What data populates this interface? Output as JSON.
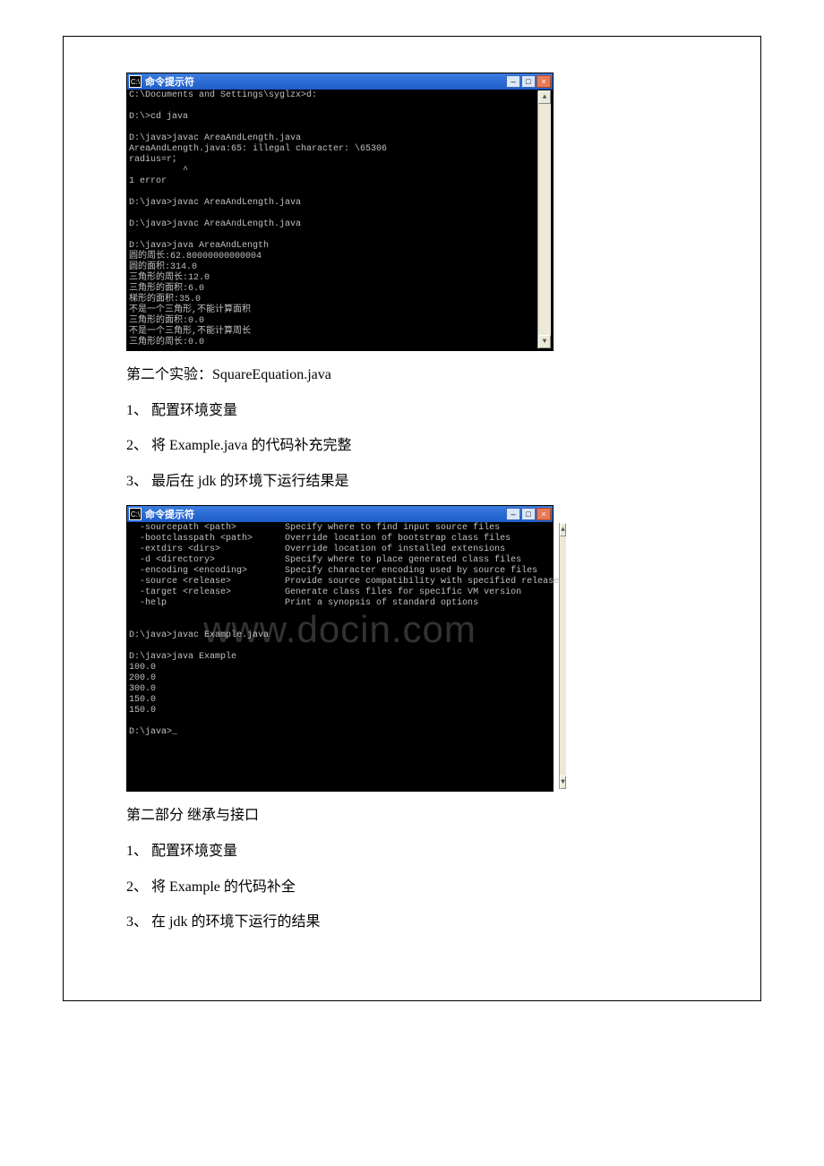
{
  "terminal1": {
    "title": "命令提示符",
    "icon_label": "cmd-icon",
    "lines": "C:\\Documents and Settings\\syglzx>d:\n\nD:\\>cd java\n\nD:\\java>javac AreaAndLength.java\nAreaAndLength.java:65: illegal character: \\65306\nradius=r；\n          ^\n1 error\n\nD:\\java>javac AreaAndLength.java\n\nD:\\java>javac AreaAndLength.java\n\nD:\\java>java AreaAndLength\n圆的周长:62.80000000000004\n圆的面积:314.0\n三角形的周长:12.0\n三角形的面积:6.0\n梯形的面积:35.0\n不是一个三角形,不能计算面积\n三角形的面积:0.0\n不是一个三角形,不能计算周长\n三角形的周长:0.0"
  },
  "section_a": {
    "heading": "第二个实验：SquareEquation.java",
    "items": [
      "1、 配置环境变量",
      "2、 将 Example.java 的代码补充完整",
      "3、 最后在 jdk 的环境下运行结果是"
    ]
  },
  "terminal2": {
    "title": "命令提示符",
    "lines": "  -sourcepath <path>         Specify where to find input source files\n  -bootclasspath <path>      Override location of bootstrap class files\n  -extdirs <dirs>            Override location of installed extensions\n  -d <directory>             Specify where to place generated class files\n  -encoding <encoding>       Specify character encoding used by source files\n  -source <release>          Provide source compatibility with specified release\n  -target <release>          Generate class files for specific VM version\n  -help                      Print a synopsis of standard options\n\n\nD:\\java>javac Example.java\n\nD:\\java>java Example\n100.0\n200.0\n300.0\n150.0\n150.0\n\nD:\\java>_"
  },
  "section_b": {
    "heading": "第二部分 继承与接口",
    "items": [
      "1、 配置环境变量",
      "2、 将 Example 的代码补全",
      "3、 在 jdk 的环境下运行的结果"
    ]
  },
  "watermark": "www.docin.com",
  "window_controls": {
    "minimize": "–",
    "maximize": "□",
    "close": "×",
    "scroll_up": "▲",
    "scroll_down": "▼"
  }
}
